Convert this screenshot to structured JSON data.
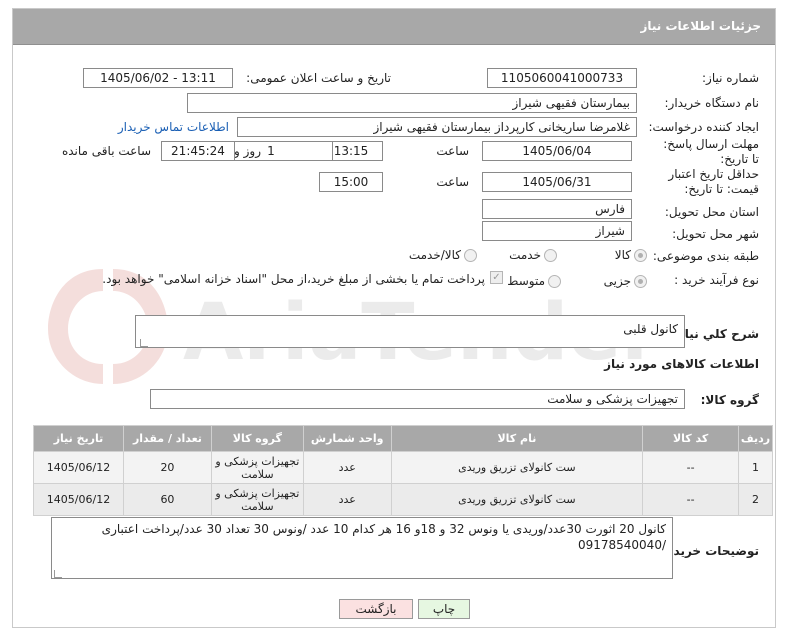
{
  "header": {
    "title": "جزئیات اطلاعات نیاز"
  },
  "labels": {
    "need_number": "شماره نیاز:",
    "announce_datetime": "تاریخ و ساعت اعلان عمومی:",
    "buyer_org": "نام دستگاه خریدار:",
    "requester": "ایجاد کننده درخواست:",
    "contact_link": "اطلاعات تماس خریدار",
    "reply_deadline": "مهلت ارسال پاسخ: تا تاریخ:",
    "hour": "ساعت",
    "day_and": "روز و",
    "remaining": "ساعت باقی مانده",
    "price_validity": "حداقل تاریخ اعتبار قیمت: تا تاریخ:",
    "province": "استان محل تحویل:",
    "city": "شهر محل تحویل:",
    "category": "طبقه بندی موضوعی:",
    "purchase_type": "نوع فرآیند خرید :",
    "need_desc": "شرح كلي نياز:",
    "goods_info": "اطلاعات کالاهای مورد نیاز",
    "goods_group": "گروه کالا:",
    "buyer_notes": "توضیحات خریدار:"
  },
  "fields": {
    "need_number": "1105060041000733",
    "announce_datetime": "1405/06/02 - 13:11",
    "buyer_org": "بیمارستان فقیهی شیراز",
    "requester": "غلامرضا ساریخانی کارپرداز بیمارستان فقیهی شیراز",
    "reply_date": "1405/06/04",
    "reply_time": "13:15",
    "reply_days": "1",
    "reply_remaining": "21:45:24",
    "price_date": "1405/06/31",
    "price_time": "15:00",
    "province": "فارس",
    "city": "شیراز",
    "need_desc": "کانول قلبی",
    "goods_group": "تجهیزات پزشکی و سلامت",
    "buyer_notes": "کانول 20 اثورت 30عدد/وریدی یا ونوس 32 و 18و 16 هر کدام 10 عدد /ونوس 30 تعداد 30 عدد/پرداخت اعتباری /09178540040"
  },
  "category_options": {
    "goods": "کالا",
    "service": "خدمت",
    "goods_service": "کالا/خدمت",
    "selected": "کالا"
  },
  "purchase_options": {
    "partial": "جزیی",
    "medium": "متوسط",
    "payment_note": "پرداخت تمام یا بخشی از مبلغ خرید،از محل \"اسناد خزانه اسلامی\" خواهد بود."
  },
  "table": {
    "headers": [
      "ردیف",
      "کد کالا",
      "نام کالا",
      "واحد شمارش",
      "گروه کالا",
      "تعداد / مقدار",
      "تاریخ نیاز"
    ],
    "rows": [
      {
        "row": "1",
        "code": "--",
        "name": "ست کانولای تزریق وریدی",
        "unit": "عدد",
        "group": "تجهیزات پزشکی و سلامت",
        "qty": "20",
        "date": "1405/06/12"
      },
      {
        "row": "2",
        "code": "--",
        "name": "ست کانولای تزریق وریدی",
        "unit": "عدد",
        "group": "تجهیزات پزشکی و سلامت",
        "qty": "60",
        "date": "1405/06/12"
      }
    ]
  },
  "buttons": {
    "print": "چاپ",
    "back": "بازگشت"
  },
  "colors": {
    "header_bg": "#a8a8a8",
    "print_bg": "#e6f7e1",
    "back_bg": "#fbe1e1",
    "link": "#1a5fb4"
  },
  "watermark": {
    "text": "AriaTender.neT"
  }
}
